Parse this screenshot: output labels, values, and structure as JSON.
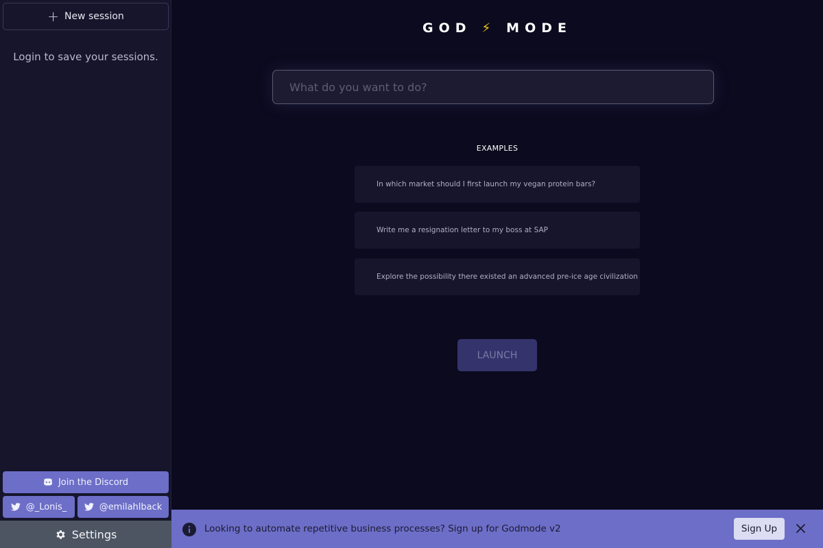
{
  "sidebar": {
    "new_session_label": "New session",
    "new_session_icon": "plus-icon",
    "login_note": "Login to save your sessions.",
    "discord_label": "Join the Discord",
    "discord_icon": "discord-icon",
    "twitter_links": [
      {
        "label": "@_Lonis_",
        "icon": "twitter-icon"
      },
      {
        "label": "@emilahlback",
        "icon": "twitter-icon"
      }
    ],
    "settings_label": "Settings",
    "settings_icon": "gear-icon"
  },
  "main": {
    "logo_left": "GOD",
    "logo_bolt": "⚡",
    "logo_right": "MODE",
    "search_placeholder": "What do you want to do?",
    "search_value": "",
    "examples_title": "EXAMPLES",
    "examples": [
      "In which market should I first launch my vegan protein bars?",
      "Write me a resignation letter to my boss at SAP",
      "Explore the possibility there existed an advanced pre-ice age civilization"
    ],
    "launch_label": "LAUNCH"
  },
  "banner": {
    "text": "Looking to automate repetitive business processes? Sign up for Godmode v2",
    "signup_label": "Sign Up",
    "info_icon": "info-icon",
    "close_icon": "close-icon"
  },
  "colors": {
    "background": "#0b0a1e",
    "sidebar": "#16152b",
    "accent": "#6c6ec7",
    "launch": "#35336b",
    "settings": "#4c5561",
    "bolt": "#f5c518"
  }
}
